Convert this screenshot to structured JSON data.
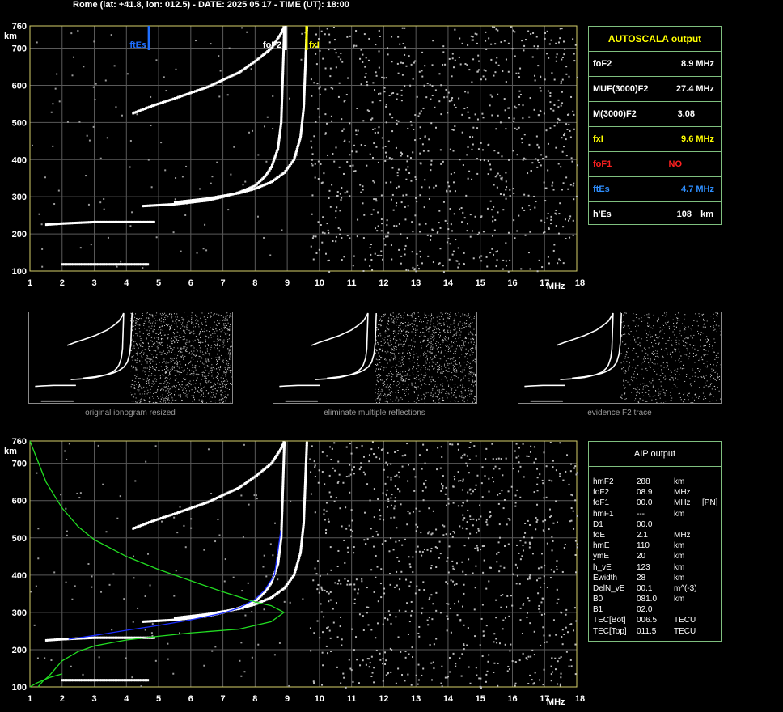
{
  "header": {
    "title": "Rome (lat: +41.8, lon: 012.5) - DATE: 2025 05 17 - TIME (UT): 18:00"
  },
  "chart_data": [
    {
      "type": "scatter",
      "panel": "top",
      "title": "",
      "xlabel": "MHz",
      "ylabel": "km",
      "xlim": [
        1,
        18
      ],
      "ylim": [
        100,
        760
      ],
      "x_ticks": [
        1,
        2,
        3,
        4,
        5,
        6,
        7,
        8,
        9,
        10,
        11,
        12,
        13,
        14,
        15,
        16,
        17,
        18
      ],
      "y_ticks": [
        100,
        200,
        300,
        400,
        500,
        600,
        700,
        760
      ],
      "grid": true,
      "markers": [
        {
          "label": "ftEs",
          "x": 4.7,
          "color": "#1f6fff"
        },
        {
          "label": "foF2",
          "x": 8.9,
          "color": "#ffffff"
        },
        {
          "label": "fxI",
          "x": 9.6,
          "color": "#ffff00"
        }
      ],
      "series": [
        {
          "x": [
            2.0,
            2.5,
            3.0,
            3.5,
            4.0,
            4.5,
            4.7
          ],
          "y": [
            118,
            118,
            118,
            118,
            118,
            118,
            118
          ]
        },
        {
          "x": [
            1.5,
            2.0,
            2.5,
            3.0,
            3.5,
            4.0,
            4.5,
            4.9
          ],
          "y": [
            225,
            228,
            230,
            232,
            232,
            232,
            232,
            232
          ]
        },
        {
          "x": [
            4.5,
            5.5,
            6.5,
            7.0,
            7.5,
            8.0,
            8.3,
            8.5,
            8.7,
            8.8,
            8.9
          ],
          "y": [
            275,
            280,
            290,
            300,
            312,
            330,
            355,
            380,
            430,
            500,
            760
          ]
        },
        {
          "x": [
            5.5,
            6.5,
            7.5,
            8.0,
            8.5,
            8.9,
            9.2,
            9.4,
            9.5,
            9.6
          ],
          "y": [
            285,
            295,
            310,
            322,
            340,
            365,
            400,
            460,
            540,
            760
          ]
        },
        {
          "x": [
            4.2,
            4.8,
            5.5,
            6.5,
            7.5,
            8.0,
            8.5,
            8.8,
            8.9
          ],
          "y": [
            525,
            545,
            565,
            595,
            635,
            665,
            700,
            740,
            760
          ]
        }
      ]
    },
    {
      "type": "scatter",
      "panel": "bottom",
      "title": "",
      "xlabel": "MHz",
      "ylabel": "km",
      "xlim": [
        1,
        18
      ],
      "ylim": [
        100,
        760
      ],
      "x_ticks": [
        1,
        2,
        3,
        4,
        5,
        6,
        7,
        8,
        9,
        10,
        11,
        12,
        13,
        14,
        15,
        16,
        17,
        18
      ],
      "y_ticks": [
        100,
        200,
        300,
        400,
        500,
        600,
        700,
        760
      ],
      "grid": true,
      "series": [
        {
          "x": [
            2.0,
            2.5,
            3.0,
            3.5,
            4.0,
            4.5,
            4.7
          ],
          "y": [
            118,
            118,
            118,
            118,
            118,
            118,
            118
          ]
        },
        {
          "x": [
            1.5,
            2.0,
            2.5,
            3.0,
            3.5,
            4.0,
            4.5,
            4.9
          ],
          "y": [
            225,
            228,
            230,
            232,
            232,
            232,
            232,
            232
          ]
        },
        {
          "x": [
            4.5,
            5.5,
            6.5,
            7.0,
            7.5,
            8.0,
            8.3,
            8.5,
            8.7,
            8.8,
            8.9
          ],
          "y": [
            275,
            280,
            290,
            300,
            312,
            330,
            355,
            380,
            430,
            500,
            760
          ]
        },
        {
          "x": [
            5.5,
            6.5,
            7.5,
            8.0,
            8.5,
            8.9,
            9.2,
            9.4,
            9.5,
            9.6
          ],
          "y": [
            285,
            295,
            310,
            322,
            340,
            365,
            400,
            460,
            540,
            760
          ]
        },
        {
          "x": [
            4.2,
            4.8,
            5.5,
            6.5,
            7.5,
            8.0,
            8.5,
            8.8,
            8.9
          ],
          "y": [
            525,
            545,
            565,
            595,
            635,
            665,
            700,
            740,
            760
          ]
        },
        {
          "color": "#1a2cff",
          "x": [
            2.2,
            3.0,
            4.0,
            5.0,
            6.0,
            7.0,
            7.5,
            8.0,
            8.3,
            8.6,
            8.8
          ],
          "y": [
            228,
            238,
            252,
            265,
            280,
            298,
            312,
            335,
            360,
            400,
            520
          ]
        },
        {
          "color": "#22dd22",
          "x": [
            1.0,
            1.5,
            2.0,
            2.5,
            3.0,
            4.0,
            5.0,
            6.0,
            7.0,
            8.0,
            8.5,
            8.9,
            8.5,
            7.5,
            6.0,
            5.0,
            4.0,
            3.0,
            2.5,
            2.0,
            1.8,
            1.6,
            1.4,
            1.25
          ],
          "y": [
            760,
            650,
            580,
            530,
            495,
            450,
            415,
            385,
            355,
            328,
            318,
            300,
            275,
            255,
            245,
            236,
            226,
            210,
            195,
            170,
            150,
            130,
            115,
            100
          ]
        },
        {
          "color": "#22dd22",
          "x": [
            1.0,
            1.2,
            1.6,
            2.0
          ],
          "y": [
            100,
            110,
            125,
            135
          ]
        }
      ]
    }
  ],
  "thumbnails": [
    {
      "caption": "original ionogram resized"
    },
    {
      "caption": "eliminate multiple reflections"
    },
    {
      "caption": "evidence F2 trace"
    }
  ],
  "autoscala": {
    "title": "AUTOSCALA output",
    "rows": [
      {
        "label": "foF2",
        "value": "8.9 MHz",
        "color": "#ffffff"
      },
      {
        "label": "MUF(3000)F2",
        "value": "27.4 MHz",
        "color": "#ffffff"
      },
      {
        "label": "M(3000)F2",
        "value": "3.08",
        "color": "#ffffff"
      },
      {
        "label": "fxI",
        "value": "9.6 MHz",
        "color": "#ffff00"
      },
      {
        "label": "foF1",
        "value": "NO",
        "color": "#ff2020"
      },
      {
        "label": "ftEs",
        "value": "4.7 MHz",
        "color": "#2f8fff"
      },
      {
        "label": "h'Es",
        "value": "108",
        "unit": "km",
        "color": "#ffffff"
      }
    ]
  },
  "aip": {
    "title": "AIP output",
    "rows": [
      {
        "label": "hmF2",
        "value": "288",
        "unit": "km"
      },
      {
        "label": "foF2",
        "value": "08.9",
        "unit": "MHz"
      },
      {
        "label": "foF1",
        "value": "00.0",
        "unit": "MHz",
        "extra": "[PN]"
      },
      {
        "label": "hmF1",
        "value": "---",
        "unit": "km"
      },
      {
        "label": "D1",
        "value": "00.0",
        "unit": ""
      },
      {
        "label": "foE",
        "value": "2.1",
        "unit": "MHz"
      },
      {
        "label": "hmE",
        "value": "110",
        "unit": "km"
      },
      {
        "label": "ymE",
        "value": "20",
        "unit": "km"
      },
      {
        "label": "h_vE",
        "value": "123",
        "unit": "km"
      },
      {
        "label": "Ewidth",
        "value": "28",
        "unit": "km"
      },
      {
        "label": "DelN_vE",
        "value": "00.1",
        "unit": "m^(-3)"
      },
      {
        "label": "B0",
        "value": "081.0",
        "unit": "km"
      },
      {
        "label": "B1",
        "value": "02.0",
        "unit": ""
      },
      {
        "label": "TEC[Bot]",
        "value": "006.5",
        "unit": "TECU"
      },
      {
        "label": "TEC[Top]",
        "value": "011.5",
        "unit": "TECU"
      }
    ]
  }
}
